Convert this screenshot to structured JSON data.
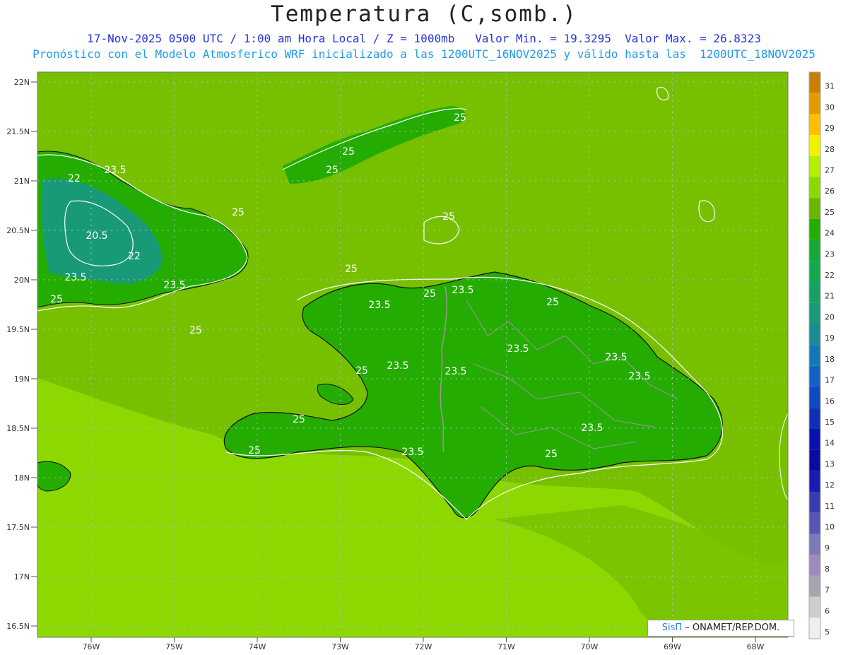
{
  "header": {
    "title": "Temperatura (C,somb.)",
    "subtitle_line1": "17-Nov-2025 0500 UTC / 1:00 am Hora Local / Z = 1000mb   Valor Min. = 19.3295  Valor Max. = 26.8323",
    "subtitle_line2": "Pronóstico con el Modelo Atmosferico WRF inicializado a las 1200UTC_16NOV2025 y válido hasta las  1200UTC_18NOV2025"
  },
  "credit": {
    "brand": "SisΠ",
    "text": " – ONAMET/REP.DOM."
  },
  "axes": {
    "lat_labels": [
      "22N",
      "21.5N",
      "21N",
      "20.5N",
      "20N",
      "19.5N",
      "19N",
      "18.5N",
      "18N",
      "17.5N",
      "17N",
      "16.5N"
    ],
    "lon_labels": [
      "76W",
      "75W",
      "74W",
      "73W",
      "72W",
      "71W",
      "70W",
      "69W",
      "68W"
    ]
  },
  "colorbar": {
    "levels": [
      "31",
      "30",
      "29",
      "28",
      "27",
      "26",
      "25",
      "24",
      "23",
      "22",
      "21",
      "20",
      "19",
      "18",
      "17",
      "16",
      "15",
      "14",
      "13",
      "12",
      "11",
      "10",
      "9",
      "8",
      "7",
      "6",
      "5"
    ],
    "colors": [
      "#c88000",
      "#e49a00",
      "#ffc000",
      "#f2f200",
      "#b4f000",
      "#8cd800",
      "#66b800",
      "#24ac00",
      "#14a838",
      "#14a84c",
      "#16a062",
      "#189a78",
      "#1a8a94",
      "#1478b8",
      "#1262c6",
      "#1248c0",
      "#1030b4",
      "#0a10b0",
      "#0a0aa4",
      "#1a1ab4",
      "#3a3ab0",
      "#5656b4",
      "#7a7ab8",
      "#9c8cbc",
      "#a6a6ae",
      "#cecece",
      "#eeeeee"
    ]
  },
  "contour_labels": [
    "23.5",
    "22",
    "20.5",
    "22",
    "23.5",
    "23.5",
    "25",
    "25",
    "25",
    "25",
    "25",
    "25",
    "25",
    "23.5",
    "23.5",
    "25",
    "23.5",
    "23.5",
    "23.5",
    "23.5",
    "23.5",
    "23.5",
    "25",
    "25",
    "25",
    "25",
    "23.5",
    "25",
    "25"
  ],
  "colors": {
    "ocean_outer": "#8cd800",
    "ocean_mid": "#76c000",
    "land": "#24ac00",
    "cuba_cool": "#189a78",
    "border": "#999999",
    "coast": "#111111",
    "contour": "#ffffff"
  }
}
